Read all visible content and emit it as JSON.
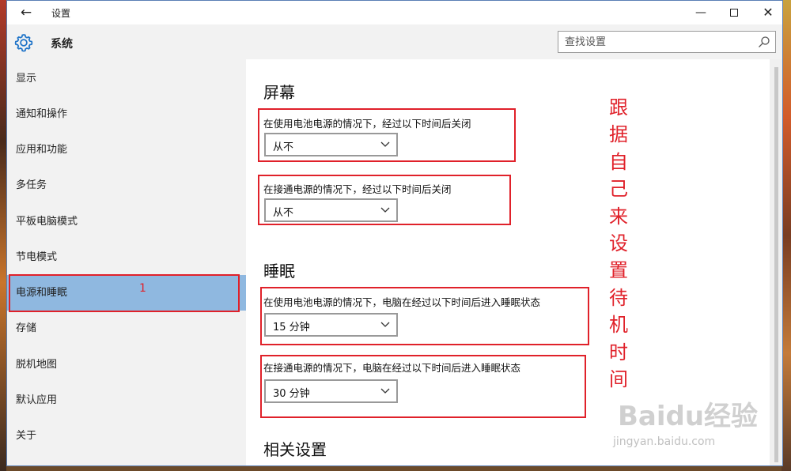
{
  "window": {
    "title": "设置",
    "back_glyph": "←",
    "minimize_glyph": "—",
    "close_glyph": "✕"
  },
  "sidebar": {
    "header_title": "系统",
    "items": [
      {
        "label": "显示"
      },
      {
        "label": "通知和操作"
      },
      {
        "label": "应用和功能"
      },
      {
        "label": "多任务"
      },
      {
        "label": "平板电脑模式"
      },
      {
        "label": "节电模式"
      },
      {
        "label": "电源和睡眠",
        "selected": true
      },
      {
        "label": "存储"
      },
      {
        "label": "脱机地图"
      },
      {
        "label": "默认应用"
      },
      {
        "label": "关于"
      }
    ]
  },
  "search": {
    "placeholder": "查找设置",
    "icon": "search-icon"
  },
  "main": {
    "screen": {
      "title": "屏幕",
      "battery_label": "在使用电池电源的情况下，经过以下时间后关闭",
      "battery_value": "从不",
      "plugged_label": "在接通电源的情况下，经过以下时间后关闭",
      "plugged_value": "从不"
    },
    "sleep": {
      "title": "睡眠",
      "battery_label": "在使用电池电源的情况下，电脑在经过以下时间后进入睡眠状态",
      "battery_value": "15 分钟",
      "plugged_label": "在接通电源的情况下，电脑在经过以下时间后进入睡眠状态",
      "plugged_value": "30 分钟"
    },
    "related": {
      "title": "相关设置"
    }
  },
  "annotations": {
    "marker_number": "1",
    "vertical_note": "跟据自己来设置待机时间",
    "accent_color": "#e0212a"
  },
  "watermark": {
    "brand": "Baidu经验",
    "url": "jingyan.baidu.com"
  },
  "colors": {
    "selected_bg": "#8fb8e0",
    "sidebar_bg": "#f2f2f2",
    "gear_blue": "#1e73c8"
  }
}
